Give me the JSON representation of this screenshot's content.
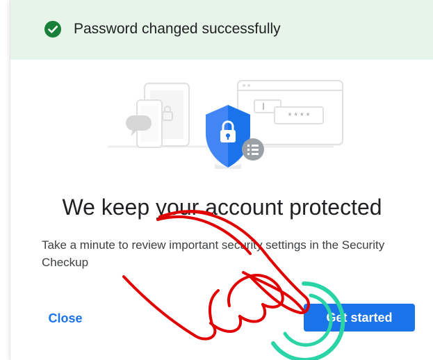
{
  "banner": {
    "message": "Password changed successfully",
    "icon": "check-circle-icon",
    "background_color": "#e6f4ea",
    "icon_color": "#188038"
  },
  "dialog": {
    "title": "We keep your account protected",
    "description": "Take a minute to review important security settings in the Security Checkup",
    "close_label": "Close",
    "start_label": "Get started",
    "accent_color": "#1a73e8"
  },
  "illustration": {
    "icon": "security-shield-illustration",
    "password_mask": "* * * *"
  },
  "overlay": {
    "icon": "hand-pointer-icon",
    "highlight": "click-ripple-indicator"
  }
}
